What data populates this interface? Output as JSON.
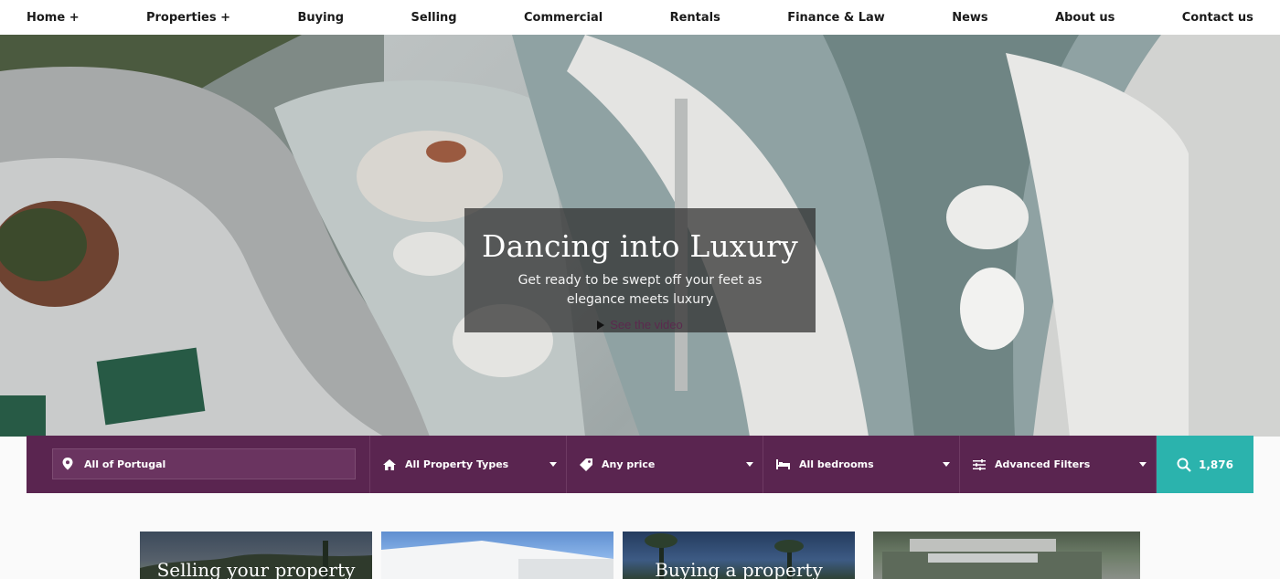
{
  "nav": {
    "items": [
      "Home +",
      "Properties +",
      "Buying",
      "Selling",
      "Commercial",
      "Rentals",
      "Finance & Law",
      "News",
      "About us",
      "Contact us"
    ]
  },
  "hero": {
    "title": "Dancing into Luxury",
    "subtitle": "Get ready to be swept off your feet as elegance meets luxury",
    "video_link": "See the video"
  },
  "search": {
    "location": "All of Portugal",
    "property_type": "All Property Types",
    "price": "Any price",
    "bedrooms": "All bedrooms",
    "advanced": "Advanced Filters",
    "result_count": "1,876",
    "colors": {
      "bar": "#5a2550",
      "button": "#2bb3ad"
    },
    "icons": [
      "location-pin-icon",
      "home-icon",
      "price-tag-icon",
      "bed-icon",
      "sliders-icon",
      "search-icon"
    ]
  },
  "cards": [
    {
      "label": "Selling your property"
    },
    {
      "label": ""
    },
    {
      "label": "Buying a property"
    },
    {
      "label": ""
    }
  ]
}
